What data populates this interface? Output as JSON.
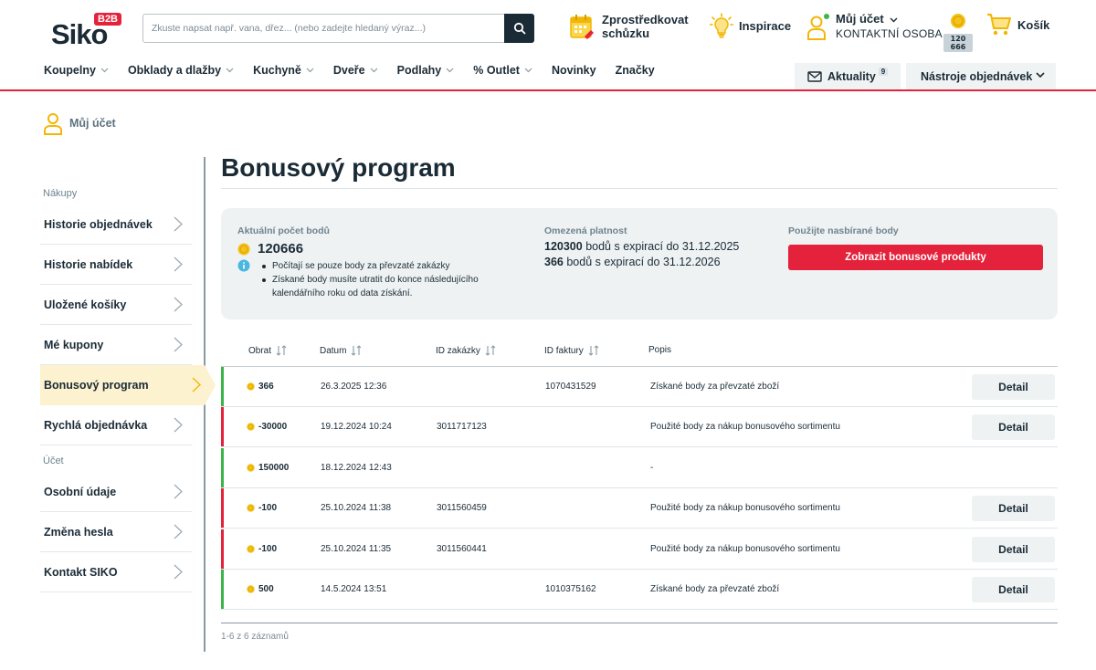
{
  "header": {
    "logo_text": "Siko",
    "logo_badge": "B2B",
    "search_placeholder": "Zkuste napsat např. vana, dřez... (nebo zadejte hledaný výraz...)",
    "meeting_label": "Zprostředkovat schůzku",
    "inspiration_label": "Inspirace",
    "account_label": "Můj účet",
    "account_sub": "KONTAKTNÍ OSOBA",
    "points_badge": "120 666",
    "cart_label": "Košík"
  },
  "nav": {
    "items": [
      {
        "label": "Koupelny"
      },
      {
        "label": "Obklady a dlažby"
      },
      {
        "label": "Kuchyně"
      },
      {
        "label": "Dveře"
      },
      {
        "label": "Podlahy"
      },
      {
        "label": "% Outlet"
      },
      {
        "label": "Novinky"
      },
      {
        "label": "Značky"
      }
    ],
    "news_label": "Aktuality",
    "news_count": "9",
    "tools_label": "Nástroje objednávek"
  },
  "sidebar": {
    "title": "Můj účet",
    "section_purchases": "Nákupy",
    "section_account": "Účet",
    "items": [
      {
        "label": "Historie objednávek"
      },
      {
        "label": "Historie nabídek"
      },
      {
        "label": "Uložené košíky"
      },
      {
        "label": "Mé kupony"
      },
      {
        "label": "Bonusový program"
      },
      {
        "label": "Rychlá objednávka"
      },
      {
        "label": "Osobní údaje"
      },
      {
        "label": "Změna hesla"
      },
      {
        "label": "Kontakt SIKO"
      }
    ]
  },
  "main": {
    "title": "Bonusový program",
    "summary": {
      "current_caption": "Aktuální počet bodů",
      "current_value": "120666",
      "notes": [
        "Počítají se pouze body za převzaté zakázky",
        "Získané body musíte utratit do konce následujícího kalendářního roku od data získání."
      ],
      "limited_caption": "Omezená platnost",
      "exp1_points": "120300",
      "exp1_text": "bodů s expirací do 31.12.2025",
      "exp2_points": "366",
      "exp2_text": "bodů s expirací do 31.12.2026",
      "use_caption": "Použijte nasbírané body",
      "use_button": "Zobrazit bonusové produkty"
    },
    "table": {
      "headers": {
        "points": "Obrat",
        "date": "Datum",
        "order_id": "ID zakázky",
        "invoice_id": "ID faktury",
        "description": "Popis"
      },
      "detail_label": "Detail",
      "rows": [
        {
          "points": "366",
          "date": "26.3.2025 12:36",
          "order_id": "",
          "invoice_id": "1070431529",
          "description": "Získané body za převzaté zboží",
          "type": "gain",
          "has_detail": true
        },
        {
          "points": "-30000",
          "date": "19.12.2024 10:24",
          "order_id": "3011717123",
          "invoice_id": "",
          "description": "Použité body za nákup bonusového sortimentu",
          "type": "spend",
          "has_detail": true
        },
        {
          "points": "150000",
          "date": "18.12.2024 12:43",
          "order_id": "",
          "invoice_id": "",
          "description": "-",
          "type": "gain",
          "has_detail": false
        },
        {
          "points": "-100",
          "date": "25.10.2024 11:38",
          "order_id": "3011560459",
          "invoice_id": "",
          "description": "Použité body za nákup bonusového sortimentu",
          "type": "spend",
          "has_detail": true
        },
        {
          "points": "-100",
          "date": "25.10.2024 11:35",
          "order_id": "3011560441",
          "invoice_id": "",
          "description": "Použité body za nákup bonusového sortimentu",
          "type": "spend",
          "has_detail": true
        },
        {
          "points": "500",
          "date": "14.5.2024 13:51",
          "order_id": "",
          "invoice_id": "1010375162",
          "description": "Získané body za převzaté zboží",
          "type": "gain",
          "has_detail": true
        }
      ],
      "records_text": "1-6 z 6 záznamů"
    }
  },
  "colors": {
    "brand_red": "#e4223b",
    "gain_green": "#3bb54a",
    "spend_red": "#e4223b",
    "coin_yellow": "#f4c21a",
    "info_blue": "#4bb7e0",
    "dark_text": "#1b2b36"
  },
  "icons": {
    "search": "search-icon",
    "meeting": "calendar-icon",
    "inspiration": "lightbulb-icon",
    "account": "user-icon",
    "points": "coin-icon",
    "cart": "cart-icon",
    "news": "mail-icon",
    "info": "info-icon"
  }
}
